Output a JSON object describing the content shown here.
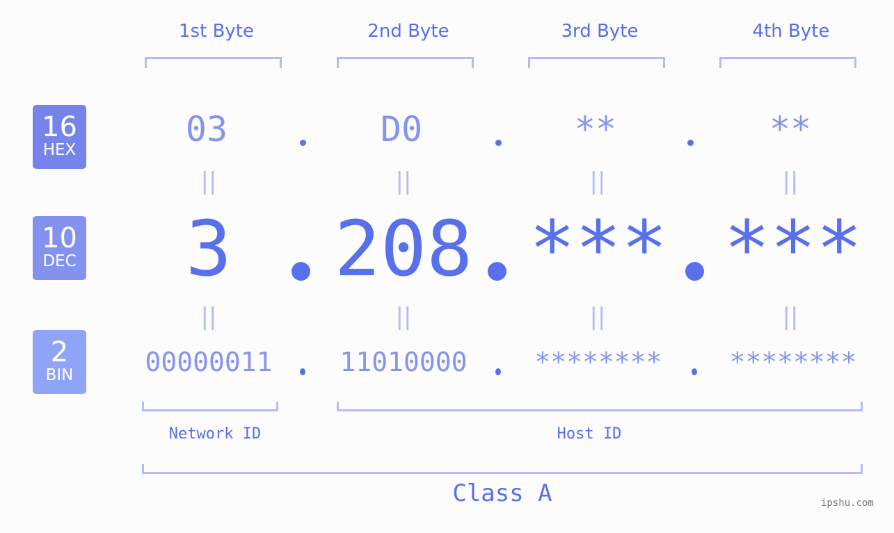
{
  "columns": [
    {
      "label": "1st Byte",
      "hex": "03",
      "dec": "3",
      "bin": "00000011"
    },
    {
      "label": "2nd Byte",
      "hex": "D0",
      "dec": "208",
      "bin": "11010000"
    },
    {
      "label": "3rd Byte",
      "hex": "**",
      "dec": "***",
      "bin": "********"
    },
    {
      "label": "4th Byte",
      "hex": "**",
      "dec": "***",
      "bin": "********"
    }
  ],
  "badges": {
    "hex": {
      "num": "16",
      "label": "HEX"
    },
    "dec": {
      "num": "10",
      "label": "DEC"
    },
    "bin": {
      "num": "2",
      "label": "BIN"
    }
  },
  "equals_symbol": "||",
  "segments": {
    "network": "Network ID",
    "host": "Host ID"
  },
  "class_label": "Class A",
  "watermark": "ipshu.com",
  "colors": {
    "hex_badge": "#7683eb",
    "dec_badge": "#8492ef",
    "bin_badge": "#8fa4f6",
    "accent": "#5870ec",
    "bracket": "#b3bcf7"
  }
}
